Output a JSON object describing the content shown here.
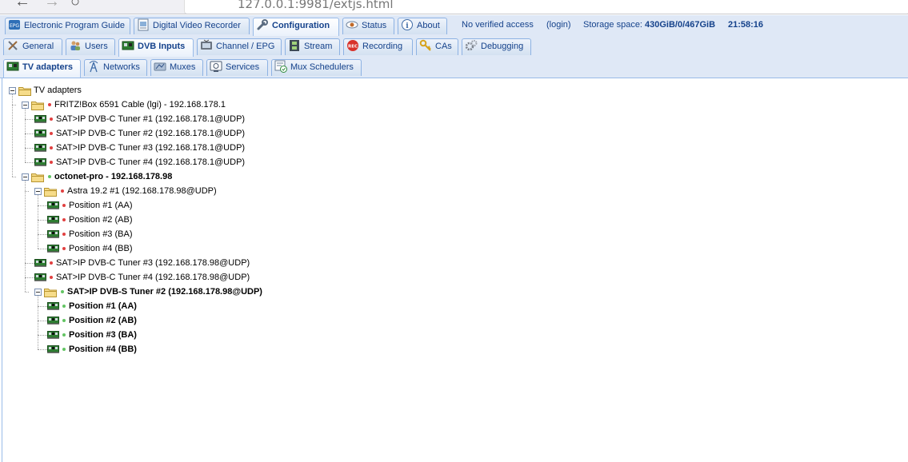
{
  "browser": {
    "url": "127.0.0.1:9981/extjs.html"
  },
  "top_tabs": [
    {
      "label": "Electronic Program Guide",
      "icon": "epg-icon"
    },
    {
      "label": "Digital Video Recorder",
      "icon": "dvr-icon"
    },
    {
      "label": "Configuration",
      "icon": "wrench-icon",
      "active": true
    },
    {
      "label": "Status",
      "icon": "eye-icon"
    },
    {
      "label": "About",
      "icon": "info-icon"
    }
  ],
  "status_bar": {
    "access": "No verified access",
    "login": "(login)",
    "storage_label": "Storage space:",
    "storage_value": "430GiB/0/467GiB",
    "time": "21:58:16"
  },
  "config_tabs": [
    {
      "label": "General",
      "icon": "tools-icon"
    },
    {
      "label": "Users",
      "icon": "users-icon"
    },
    {
      "label": "DVB Inputs",
      "icon": "tuner-card-icon",
      "active": true
    },
    {
      "label": "Channel / EPG",
      "icon": "tv-icon"
    },
    {
      "label": "Stream",
      "icon": "film-icon"
    },
    {
      "label": "Recording",
      "icon": "rec-icon"
    },
    {
      "label": "CAs",
      "icon": "key-icon"
    },
    {
      "label": "Debugging",
      "icon": "gears-icon"
    }
  ],
  "dvb_tabs": [
    {
      "label": "TV adapters",
      "icon": "tuner-card-icon",
      "active": true
    },
    {
      "label": "Networks",
      "icon": "antenna-icon"
    },
    {
      "label": "Muxes",
      "icon": "mux-icon"
    },
    {
      "label": "Services",
      "icon": "services-icon"
    },
    {
      "label": "Mux Schedulers",
      "icon": "scheduler-icon"
    }
  ],
  "tree": [
    {
      "label": "TV adapters",
      "type": "folder",
      "depth": 0
    },
    {
      "label": "FRITZ!Box 6591 Cable (lgi) - 192.168.178.1",
      "type": "folder",
      "depth": 1,
      "status": "red"
    },
    {
      "label": "SAT>IP DVB-C Tuner #1 (192.168.178.1@UDP)",
      "type": "card",
      "depth": 2,
      "status": "red"
    },
    {
      "label": "SAT>IP DVB-C Tuner #2 (192.168.178.1@UDP)",
      "type": "card",
      "depth": 2,
      "status": "red"
    },
    {
      "label": "SAT>IP DVB-C Tuner #3 (192.168.178.1@UDP)",
      "type": "card",
      "depth": 2,
      "status": "red"
    },
    {
      "label": "SAT>IP DVB-C Tuner #4 (192.168.178.1@UDP)",
      "type": "card",
      "depth": 2,
      "status": "red"
    },
    {
      "label": "octonet-pro - 192.168.178.98",
      "type": "folder",
      "depth": 1,
      "status": "green",
      "bold": true
    },
    {
      "label": "Astra 19.2 #1 (192.168.178.98@UDP)",
      "type": "folder",
      "depth": 2,
      "status": "red"
    },
    {
      "label": "Position #1 (AA)",
      "type": "card",
      "depth": 3,
      "status": "red"
    },
    {
      "label": "Position #2 (AB)",
      "type": "card",
      "depth": 3,
      "status": "red"
    },
    {
      "label": "Position #3 (BA)",
      "type": "card",
      "depth": 3,
      "status": "red"
    },
    {
      "label": "Position #4 (BB)",
      "type": "card",
      "depth": 3,
      "status": "red"
    },
    {
      "label": "SAT>IP DVB-C Tuner #3 (192.168.178.98@UDP)",
      "type": "card",
      "depth": 2,
      "status": "red"
    },
    {
      "label": "SAT>IP DVB-C Tuner #4 (192.168.178.98@UDP)",
      "type": "card",
      "depth": 2,
      "status": "red"
    },
    {
      "label": "SAT>IP DVB-S Tuner #2 (192.168.178.98@UDP)",
      "type": "folder",
      "depth": 2,
      "status": "green",
      "bold": true
    },
    {
      "label": "Position #1 (AA)",
      "type": "card",
      "depth": 3,
      "status": "green",
      "bold": true
    },
    {
      "label": "Position #2 (AB)",
      "type": "card",
      "depth": 3,
      "status": "green",
      "bold": true
    },
    {
      "label": "Position #3 (BA)",
      "type": "card",
      "depth": 3,
      "status": "green",
      "bold": true
    },
    {
      "label": "Position #4 (BB)",
      "type": "card",
      "depth": 3,
      "status": "green",
      "bold": true
    }
  ],
  "colors": {
    "accent": "#15428b",
    "tab_bg": "#dfe8f6",
    "status_red": "#e14040",
    "status_green": "#63c463"
  }
}
